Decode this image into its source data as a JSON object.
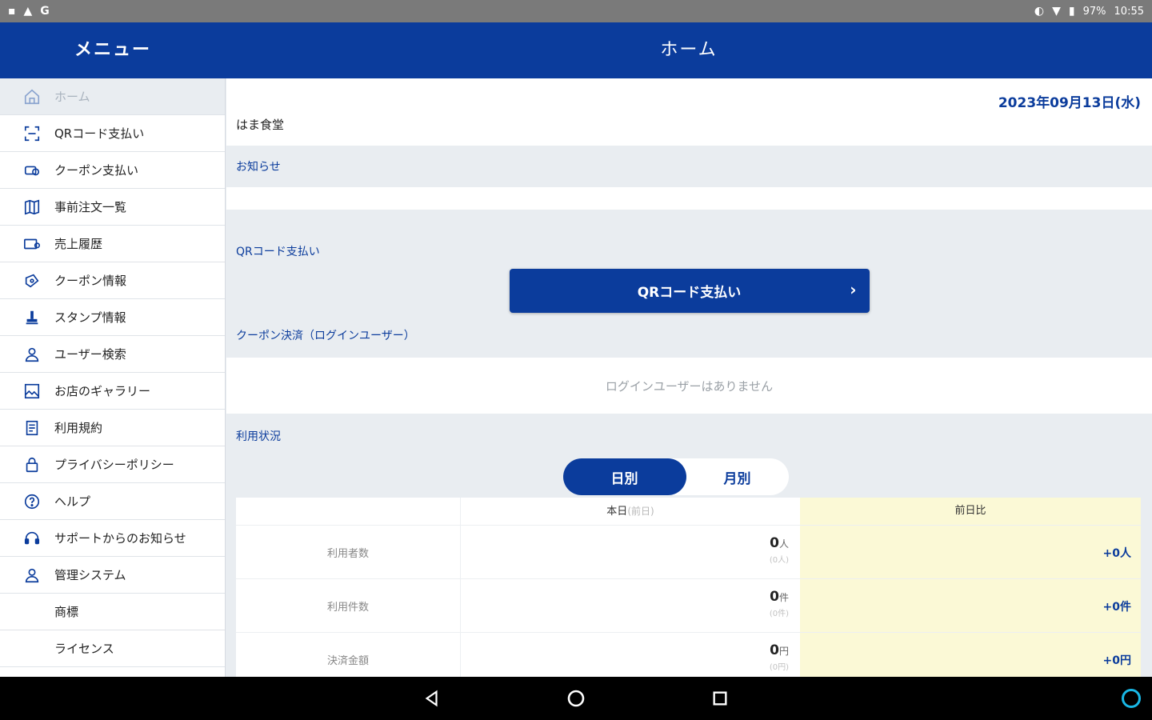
{
  "status_bar": {
    "left_icons": [
      "notification-icon",
      "alert-icon",
      "google-icon"
    ],
    "battery": "97%",
    "time": "10:55"
  },
  "header": {
    "menu_title": "メニュー",
    "page_title": "ホーム"
  },
  "sidebar": {
    "items": [
      {
        "label": "ホーム",
        "icon": "home-icon"
      },
      {
        "label": "QRコード支払い",
        "icon": "qr-scan-icon"
      },
      {
        "label": "クーポン支払い",
        "icon": "coupon-pay-icon"
      },
      {
        "label": "事前注文一覧",
        "icon": "map-icon"
      },
      {
        "label": "売上履歴",
        "icon": "sales-icon"
      },
      {
        "label": "クーポン情報",
        "icon": "coupon-icon"
      },
      {
        "label": "スタンプ情報",
        "icon": "stamp-icon"
      },
      {
        "label": "ユーザー検索",
        "icon": "user-icon"
      },
      {
        "label": "お店のギャラリー",
        "icon": "gallery-icon"
      },
      {
        "label": "利用規約",
        "icon": "document-icon"
      },
      {
        "label": "プライバシーポリシー",
        "icon": "lock-icon"
      },
      {
        "label": "ヘルプ",
        "icon": "help-icon"
      },
      {
        "label": "サポートからのお知らせ",
        "icon": "headset-icon"
      },
      {
        "label": "管理システム",
        "icon": "admin-icon"
      },
      {
        "label": "商標",
        "icon": ""
      },
      {
        "label": "ライセンス",
        "icon": ""
      }
    ]
  },
  "main": {
    "date": "2023年09月13日(水)",
    "shop_name": "はま食堂",
    "notice_label": "お知らせ",
    "qr_section_label": "QRコード支払い",
    "qr_button_label": "QRコード支払い",
    "coupon_section_label": "クーポン決済（ログインユーザー）",
    "no_login_users": "ログインユーザーはありません",
    "usage_label": "利用状況",
    "toggle": {
      "daily": "日別",
      "monthly": "月別"
    },
    "stats": {
      "col_today": "本日",
      "col_today_sub": "(前日)",
      "col_prev": "前日比",
      "rows": [
        {
          "label": "利用者数",
          "value": "0",
          "unit": "人",
          "prev": "(0人)",
          "diff": "+0人"
        },
        {
          "label": "利用件数",
          "value": "0",
          "unit": "件",
          "prev": "(0件)",
          "diff": "+0件"
        },
        {
          "label": "決済金額",
          "value": "0",
          "unit": "円",
          "prev": "(0円)",
          "diff": "+0円"
        }
      ]
    }
  },
  "colors": {
    "primary": "#0b3c9c",
    "background": "#e9edf1",
    "highlight": "#fbf9d6"
  }
}
